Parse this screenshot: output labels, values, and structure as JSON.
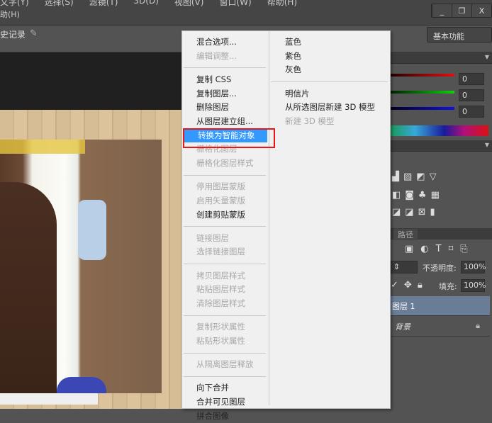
{
  "menubar": {
    "items": [
      "文字(Y)",
      "选择(S)",
      "滤镜(T)",
      "3D(D)",
      "视图(V)",
      "窗口(W)",
      "帮助(H)"
    ],
    "second_row": "助(H)",
    "window_buttons": [
      "_",
      "❐",
      "X"
    ]
  },
  "options": {
    "history_label": "史记录",
    "workspace": "基本功能"
  },
  "color_panel": {
    "r": "0",
    "g": "0",
    "b": "0",
    "colors": {
      "r": "#e01010",
      "g": "#10d010",
      "b": "#1010e0"
    }
  },
  "layers_panel": {
    "tab": "路径",
    "opacity_label": "不透明度:",
    "opacity": "100%",
    "fill_label": "填充:",
    "fill": "100%",
    "layers": [
      {
        "name": "图层 1",
        "selected": true
      },
      {
        "name": "背景",
        "locked": true
      }
    ]
  },
  "context_menu": {
    "left": [
      {
        "label": "混合选项...",
        "enabled": true
      },
      {
        "label": "编辑调整...",
        "enabled": false
      },
      {
        "sep": true
      },
      {
        "label": "复制 CSS",
        "enabled": true
      },
      {
        "label": "复制图层...",
        "enabled": true
      },
      {
        "label": "删除图层",
        "enabled": true
      },
      {
        "label": "从图层建立组...",
        "enabled": true
      },
      {
        "label": "转换为智能对象",
        "enabled": true,
        "highlighted": true
      },
      {
        "label": "栅格化图层",
        "enabled": false
      },
      {
        "label": "栅格化图层样式",
        "enabled": false
      },
      {
        "sep": true
      },
      {
        "label": "停用图层蒙版",
        "enabled": false
      },
      {
        "label": "启用矢量蒙版",
        "enabled": false
      },
      {
        "label": "创建剪贴蒙版",
        "enabled": true
      },
      {
        "sep": true
      },
      {
        "label": "链接图层",
        "enabled": false
      },
      {
        "label": "选择链接图层",
        "enabled": false
      },
      {
        "sep": true
      },
      {
        "label": "拷贝图层样式",
        "enabled": false
      },
      {
        "label": "粘贴图层样式",
        "enabled": false
      },
      {
        "label": "清除图层样式",
        "enabled": false
      },
      {
        "sep": true
      },
      {
        "label": "复制形状属性",
        "enabled": false
      },
      {
        "label": "粘贴形状属性",
        "enabled": false
      },
      {
        "sep": true
      },
      {
        "label": "从隔离图层释放",
        "enabled": false
      },
      {
        "sep": true
      },
      {
        "label": "向下合并",
        "enabled": true
      },
      {
        "label": "合并可见图层",
        "enabled": true
      },
      {
        "label": "拼合图像",
        "enabled": true
      }
    ],
    "right": [
      {
        "label": "蓝色",
        "enabled": true
      },
      {
        "label": "紫色",
        "enabled": true
      },
      {
        "label": "灰色",
        "enabled": true
      },
      {
        "sep": true
      },
      {
        "label": "明信片",
        "enabled": true
      },
      {
        "label": "从所选图层新建 3D 模型",
        "enabled": true
      },
      {
        "label": "新建 3D 模型",
        "enabled": false
      }
    ]
  },
  "highlight_color": "#3399ff"
}
